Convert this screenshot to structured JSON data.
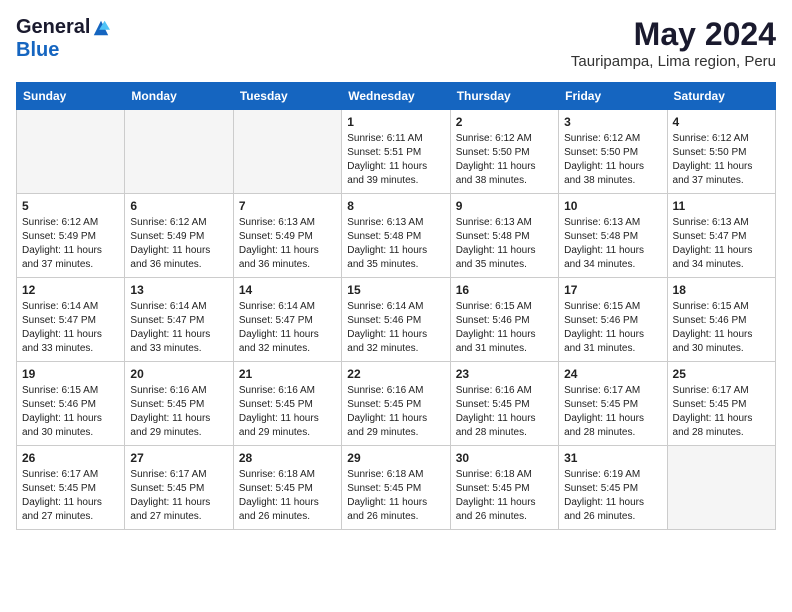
{
  "header": {
    "logo_general": "General",
    "logo_blue": "Blue",
    "month": "May 2024",
    "location": "Tauripampa, Lima region, Peru"
  },
  "days_of_week": [
    "Sunday",
    "Monday",
    "Tuesday",
    "Wednesday",
    "Thursday",
    "Friday",
    "Saturday"
  ],
  "weeks": [
    [
      {
        "day": "",
        "content": ""
      },
      {
        "day": "",
        "content": ""
      },
      {
        "day": "",
        "content": ""
      },
      {
        "day": "1",
        "content": "Sunrise: 6:11 AM\nSunset: 5:51 PM\nDaylight: 11 hours and 39 minutes."
      },
      {
        "day": "2",
        "content": "Sunrise: 6:12 AM\nSunset: 5:50 PM\nDaylight: 11 hours and 38 minutes."
      },
      {
        "day": "3",
        "content": "Sunrise: 6:12 AM\nSunset: 5:50 PM\nDaylight: 11 hours and 38 minutes."
      },
      {
        "day": "4",
        "content": "Sunrise: 6:12 AM\nSunset: 5:50 PM\nDaylight: 11 hours and 37 minutes."
      }
    ],
    [
      {
        "day": "5",
        "content": "Sunrise: 6:12 AM\nSunset: 5:49 PM\nDaylight: 11 hours and 37 minutes."
      },
      {
        "day": "6",
        "content": "Sunrise: 6:12 AM\nSunset: 5:49 PM\nDaylight: 11 hours and 36 minutes."
      },
      {
        "day": "7",
        "content": "Sunrise: 6:13 AM\nSunset: 5:49 PM\nDaylight: 11 hours and 36 minutes."
      },
      {
        "day": "8",
        "content": "Sunrise: 6:13 AM\nSunset: 5:48 PM\nDaylight: 11 hours and 35 minutes."
      },
      {
        "day": "9",
        "content": "Sunrise: 6:13 AM\nSunset: 5:48 PM\nDaylight: 11 hours and 35 minutes."
      },
      {
        "day": "10",
        "content": "Sunrise: 6:13 AM\nSunset: 5:48 PM\nDaylight: 11 hours and 34 minutes."
      },
      {
        "day": "11",
        "content": "Sunrise: 6:13 AM\nSunset: 5:47 PM\nDaylight: 11 hours and 34 minutes."
      }
    ],
    [
      {
        "day": "12",
        "content": "Sunrise: 6:14 AM\nSunset: 5:47 PM\nDaylight: 11 hours and 33 minutes."
      },
      {
        "day": "13",
        "content": "Sunrise: 6:14 AM\nSunset: 5:47 PM\nDaylight: 11 hours and 33 minutes."
      },
      {
        "day": "14",
        "content": "Sunrise: 6:14 AM\nSunset: 5:47 PM\nDaylight: 11 hours and 32 minutes."
      },
      {
        "day": "15",
        "content": "Sunrise: 6:14 AM\nSunset: 5:46 PM\nDaylight: 11 hours and 32 minutes."
      },
      {
        "day": "16",
        "content": "Sunrise: 6:15 AM\nSunset: 5:46 PM\nDaylight: 11 hours and 31 minutes."
      },
      {
        "day": "17",
        "content": "Sunrise: 6:15 AM\nSunset: 5:46 PM\nDaylight: 11 hours and 31 minutes."
      },
      {
        "day": "18",
        "content": "Sunrise: 6:15 AM\nSunset: 5:46 PM\nDaylight: 11 hours and 30 minutes."
      }
    ],
    [
      {
        "day": "19",
        "content": "Sunrise: 6:15 AM\nSunset: 5:46 PM\nDaylight: 11 hours and 30 minutes."
      },
      {
        "day": "20",
        "content": "Sunrise: 6:16 AM\nSunset: 5:45 PM\nDaylight: 11 hours and 29 minutes."
      },
      {
        "day": "21",
        "content": "Sunrise: 6:16 AM\nSunset: 5:45 PM\nDaylight: 11 hours and 29 minutes."
      },
      {
        "day": "22",
        "content": "Sunrise: 6:16 AM\nSunset: 5:45 PM\nDaylight: 11 hours and 29 minutes."
      },
      {
        "day": "23",
        "content": "Sunrise: 6:16 AM\nSunset: 5:45 PM\nDaylight: 11 hours and 28 minutes."
      },
      {
        "day": "24",
        "content": "Sunrise: 6:17 AM\nSunset: 5:45 PM\nDaylight: 11 hours and 28 minutes."
      },
      {
        "day": "25",
        "content": "Sunrise: 6:17 AM\nSunset: 5:45 PM\nDaylight: 11 hours and 28 minutes."
      }
    ],
    [
      {
        "day": "26",
        "content": "Sunrise: 6:17 AM\nSunset: 5:45 PM\nDaylight: 11 hours and 27 minutes."
      },
      {
        "day": "27",
        "content": "Sunrise: 6:17 AM\nSunset: 5:45 PM\nDaylight: 11 hours and 27 minutes."
      },
      {
        "day": "28",
        "content": "Sunrise: 6:18 AM\nSunset: 5:45 PM\nDaylight: 11 hours and 26 minutes."
      },
      {
        "day": "29",
        "content": "Sunrise: 6:18 AM\nSunset: 5:45 PM\nDaylight: 11 hours and 26 minutes."
      },
      {
        "day": "30",
        "content": "Sunrise: 6:18 AM\nSunset: 5:45 PM\nDaylight: 11 hours and 26 minutes."
      },
      {
        "day": "31",
        "content": "Sunrise: 6:19 AM\nSunset: 5:45 PM\nDaylight: 11 hours and 26 minutes."
      },
      {
        "day": "",
        "content": ""
      }
    ]
  ]
}
